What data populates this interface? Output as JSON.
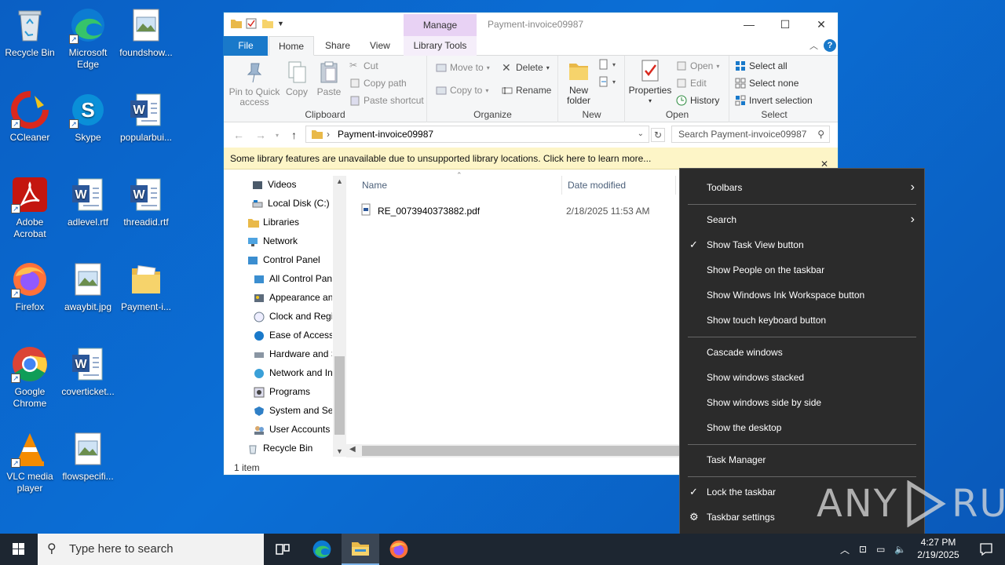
{
  "desktop": {
    "icons": [
      {
        "label": "Recycle Bin",
        "icon": "recycle-bin-icon"
      },
      {
        "label": "Microsoft Edge",
        "icon": "edge-icon"
      },
      {
        "label": "foundshow...",
        "icon": "image-file-icon"
      },
      {
        "label": "CCleaner",
        "icon": "ccleaner-icon"
      },
      {
        "label": "Skype",
        "icon": "skype-icon"
      },
      {
        "label": "popularbui...",
        "icon": "word-doc-icon"
      },
      {
        "label": "Adobe Acrobat",
        "icon": "acrobat-icon"
      },
      {
        "label": "adlevel.rtf",
        "icon": "word-doc-icon"
      },
      {
        "label": "threadid.rtf",
        "icon": "word-doc-icon"
      },
      {
        "label": "Firefox",
        "icon": "firefox-icon"
      },
      {
        "label": "awaybit.jpg",
        "icon": "image-file-icon"
      },
      {
        "label": "Payment-i...",
        "icon": "folder-icon"
      },
      {
        "label": "Google Chrome",
        "icon": "chrome-icon"
      },
      {
        "label": "coverticket...",
        "icon": "word-doc-icon"
      },
      {
        "label": "VLC media player",
        "icon": "vlc-icon"
      },
      {
        "label": "flowspecifi...",
        "icon": "image-file-icon"
      }
    ]
  },
  "explorer": {
    "title": "Payment-invoice09987",
    "manage_label": "Manage",
    "window_buttons": {
      "minimize": "—",
      "maximize": "☐",
      "close": "✕"
    },
    "tabs": {
      "file": "File",
      "home": "Home",
      "share": "Share",
      "view": "View",
      "library_tools": "Library Tools"
    },
    "ribbon": {
      "clipboard": {
        "label": "Clipboard",
        "pin": "Pin to Quick access",
        "copy": "Copy",
        "paste": "Paste",
        "cut": "Cut",
        "copy_path": "Copy path",
        "paste_shortcut": "Paste shortcut"
      },
      "organize": {
        "label": "Organize",
        "move_to": "Move to",
        "copy_to": "Copy to",
        "delete": "Delete",
        "rename": "Rename"
      },
      "new": {
        "label": "New",
        "new_folder": "New folder"
      },
      "open": {
        "label": "Open",
        "properties": "Properties",
        "open": "Open",
        "edit": "Edit",
        "history": "History"
      },
      "select": {
        "label": "Select",
        "select_all": "Select all",
        "select_none": "Select none",
        "invert": "Invert selection"
      }
    },
    "address": "Payment-invoice09987",
    "search_placeholder": "Search Payment-invoice09987",
    "infobar": "Some library features are unavailable due to unsupported library locations. Click here to learn more...",
    "nav": [
      {
        "label": "Videos",
        "icon": "videos-icon"
      },
      {
        "label": "Local Disk (C:)",
        "icon": "drive-icon"
      },
      {
        "label": "Libraries",
        "icon": "libraries-icon"
      },
      {
        "label": "Network",
        "icon": "network-icon"
      },
      {
        "label": "Control Panel",
        "icon": "control-panel-icon"
      },
      {
        "label": "All Control Panel Items",
        "icon": "control-panel-icon"
      },
      {
        "label": "Appearance and Personalization",
        "icon": "appearance-icon"
      },
      {
        "label": "Clock and Region",
        "icon": "clock-icon"
      },
      {
        "label": "Ease of Access",
        "icon": "ease-of-access-icon"
      },
      {
        "label": "Hardware and Sound",
        "icon": "hardware-icon"
      },
      {
        "label": "Network and Internet",
        "icon": "network-internet-icon"
      },
      {
        "label": "Programs",
        "icon": "programs-icon"
      },
      {
        "label": "System and Security",
        "icon": "system-security-icon"
      },
      {
        "label": "User Accounts",
        "icon": "user-accounts-icon"
      },
      {
        "label": "Recycle Bin",
        "icon": "recycle-bin-icon"
      }
    ],
    "columns": {
      "name": "Name",
      "date_modified": "Date modified"
    },
    "files": [
      {
        "name": "RE_0073940373882.pdf",
        "date": "2/18/2025 11:53 AM"
      }
    ],
    "status": "1 item"
  },
  "context_menu": {
    "items": [
      {
        "label": "Toolbars",
        "submenu": true
      },
      {
        "label": "Search",
        "submenu": true
      },
      {
        "label": "Show Task View button",
        "checked": true
      },
      {
        "label": "Show People on the taskbar"
      },
      {
        "label": "Show Windows Ink Workspace button"
      },
      {
        "label": "Show touch keyboard button"
      },
      {
        "label": "Cascade windows"
      },
      {
        "label": "Show windows stacked"
      },
      {
        "label": "Show windows side by side"
      },
      {
        "label": "Show the desktop"
      },
      {
        "label": "Task Manager"
      },
      {
        "label": "Lock the taskbar",
        "checked": true
      },
      {
        "label": "Taskbar settings",
        "icon": "gear-icon"
      }
    ]
  },
  "watermark": {
    "text_left": "ANY",
    "text_right": "RUN"
  },
  "taskbar": {
    "search_placeholder": "Type here to search",
    "time": "4:27 PM",
    "date": "2/19/2025"
  }
}
